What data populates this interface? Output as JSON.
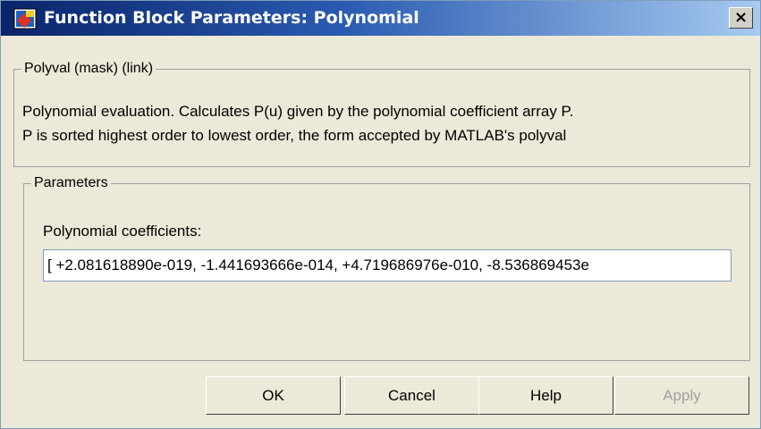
{
  "window": {
    "title": "Function Block Parameters: Polynomial",
    "close_label": "×"
  },
  "description_group": {
    "legend": "Polyval (mask) (link)",
    "line1": "Polynomial evaluation.  Calculates P(u) given by the polynomial coefficient array P.",
    "line2": "P is sorted highest order to lowest order, the form accepted by MATLAB's polyval"
  },
  "parameters_group": {
    "legend": "Parameters",
    "coefficients_label": "Polynomial coefficients:",
    "coefficients_value": "[ +2.081618890e-019, -1.441693666e-014, +4.719686976e-010, -8.536869453e"
  },
  "buttons": {
    "ok": "OK",
    "cancel": "Cancel",
    "help": "Help",
    "apply": "Apply"
  }
}
